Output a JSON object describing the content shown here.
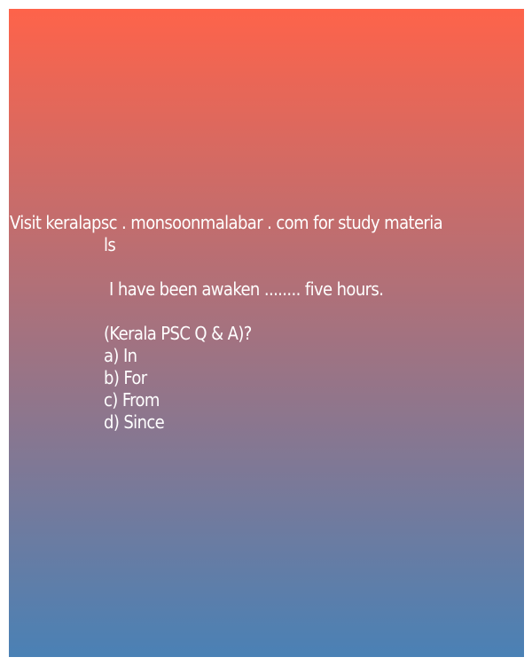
{
  "promo": {
    "line1": "Visit keralapsc . monsoonmalabar . com for study materia",
    "line2": "ls"
  },
  "question": {
    "text": "I have been awaken ........ five hours.",
    "source": "(Kerala PSC Q & A)?",
    "options": [
      "a) In",
      "b) For",
      "c) From",
      "d) Since"
    ]
  },
  "colors": {
    "gradient_top": "#fe634a",
    "gradient_bottom": "#4a81b5",
    "text": "#ffffff"
  }
}
